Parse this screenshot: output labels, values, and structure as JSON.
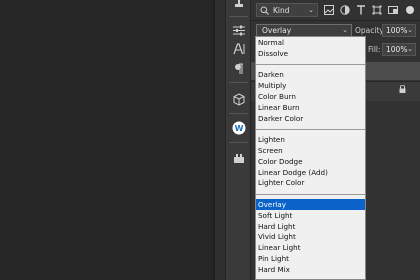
{
  "layers_panel": {
    "kind_filter": {
      "label": "Kind"
    },
    "blend_mode": {
      "value": "Overlay"
    },
    "opacity": {
      "label": "Opacity:",
      "value": "100%"
    },
    "fill": {
      "label": "Fill:",
      "value": "100%"
    }
  },
  "toolbar_icons": [
    "stamp-icon",
    "adjustments-icon",
    "character-icon",
    "paragraph-icon",
    "3d-cube-icon",
    "wordpress-icon",
    "plugin-icon"
  ],
  "blend_menu": {
    "groups": [
      [
        "Normal",
        "Dissolve"
      ],
      [
        "Darken",
        "Multiply",
        "Color Burn",
        "Linear Burn",
        "Darker Color"
      ],
      [
        "Lighten",
        "Screen",
        "Color Dodge",
        "Linear Dodge (Add)",
        "Lighter Color"
      ],
      [
        "Overlay",
        "Soft Light",
        "Hard Light",
        "Vivid Light",
        "Linear Light",
        "Pin Light",
        "Hard Mix"
      ]
    ],
    "selected": "Overlay"
  },
  "colors": {
    "highlight": "#0b62c9",
    "menu_bg": "#f0f0f0",
    "panel_bg": "#323232"
  }
}
